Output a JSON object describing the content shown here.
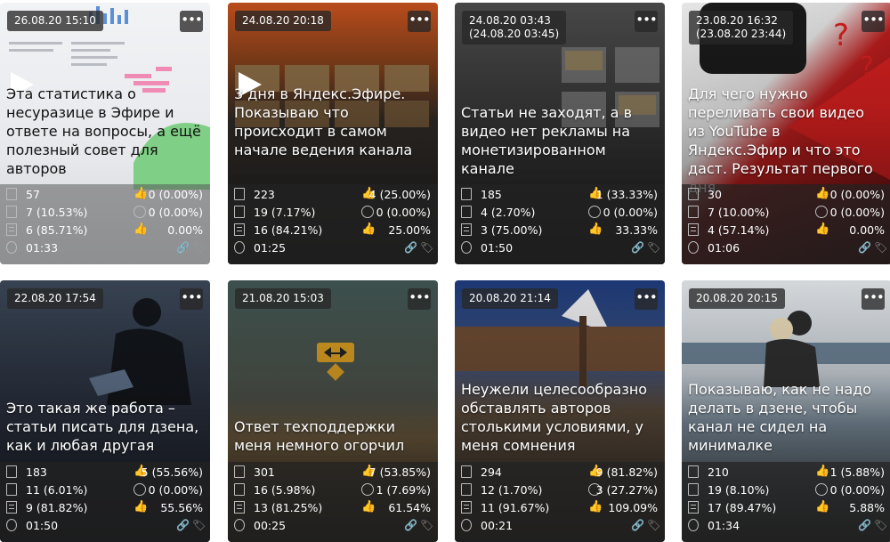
{
  "cards": [
    {
      "date": "26.08.20 15:10",
      "title": "Эта статистика о несуразице в Эфире и ответе на вопросы, а ещё полезный совет для авторов",
      "views": "57",
      "reads": "7 (10.53%)",
      "readthrough": "6 (85.71%)",
      "time": "01:33",
      "likes": "0 (0.00%)",
      "comments": "0 (0.00%)",
      "ctr": "0.00%",
      "bg": "#eef0f3",
      "video": true
    },
    {
      "date": "24.08.20 20:18",
      "title": "3 дня в Яндекс.Эфире. Показываю что происходит в самом начале ведения канала",
      "views": "223",
      "reads": "19 (7.17%)",
      "readthrough": "16 (84.21%)",
      "time": "01:25",
      "likes": "4 (25.00%)",
      "comments": "0 (0.00%)",
      "ctr": "25.00%",
      "bg": "#5a3a22",
      "video": true
    },
    {
      "date": "24.08.20 03:43\n(24.08.20 03:45)",
      "title": "Статьи не заходят, а в видео нет рекламы на монетизированном канале",
      "views": "185",
      "reads": "4 (2.70%)",
      "readthrough": "3 (75.00%)",
      "time": "01:50",
      "likes": "1 (33.33%)",
      "comments": "0 (0.00%)",
      "ctr": "33.33%",
      "bg": "#3a3a3a",
      "video": false
    },
    {
      "date": "23.08.20 16:32\n(23.08.20 23:44)",
      "title": "Для чего нужно переливать свои видео из YouTube в Яндекс.Эфир и что это даст. Результат первого дня",
      "views": "30",
      "reads": "7 (10.00%)",
      "readthrough": "4 (57.14%)",
      "time": "01:06",
      "likes": "0 (0.00%)",
      "comments": "0 (0.00%)",
      "ctr": "0.00%",
      "bg": "#8a1a1a",
      "video": false
    },
    {
      "date": "22.08.20 17:54",
      "title": "Это такая же работа – статьи писать для дзена, как и любая другая",
      "views": "183",
      "reads": "11 (6.01%)",
      "readthrough": "9 (81.82%)",
      "time": "01:50",
      "likes": "5 (55.56%)",
      "comments": "0 (0.00%)",
      "ctr": "55.56%",
      "bg": "#2d3440",
      "video": false
    },
    {
      "date": "21.08.20 15:03",
      "title": "Ответ техподдержки меня немного огорчил",
      "views": "301",
      "reads": "16 (5.98%)",
      "readthrough": "13 (81.25%)",
      "time": "00:25",
      "likes": "7 (53.85%)",
      "comments": "1 (7.69%)",
      "ctr": "61.54%",
      "bg": "#3b4a46",
      "video": false
    },
    {
      "date": "20.08.20 21:14",
      "title": "Неужели целесообразно обставлять авторов столькими условиями, у меня сомнения",
      "views": "294",
      "reads": "12 (1.70%)",
      "readthrough": "11 (91.67%)",
      "time": "00:21",
      "likes": "9 (81.82%)",
      "comments": "3 (27.27%)",
      "ctr": "109.09%",
      "bg": "#3a3f4a",
      "video": false
    },
    {
      "date": "20.08.20 20:15",
      "title": "Показываю, как не надо делать в дзене, чтобы канал не сидел на минималке",
      "views": "210",
      "reads": "19 (8.10%)",
      "readthrough": "17 (89.47%)",
      "time": "01:34",
      "likes": "1 (5.88%)",
      "comments": "0 (0.00%)",
      "ctr": "5.88%",
      "bg": "#9aa3ab",
      "video": false
    }
  ]
}
